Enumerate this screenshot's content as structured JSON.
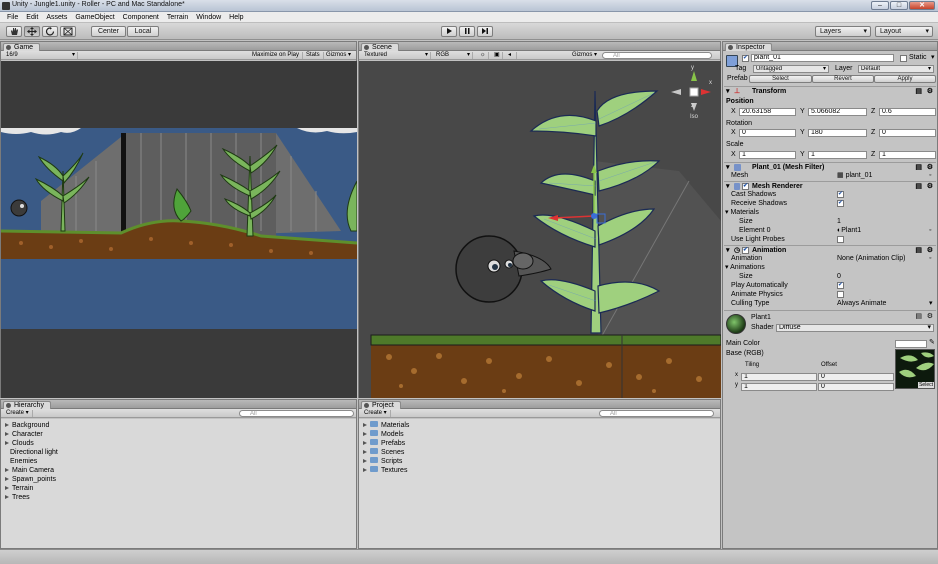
{
  "window": {
    "title": "Unity - Jungle1.unity - Roller - PC and Mac Standalone*",
    "min": "–",
    "max": "□",
    "close": "✕"
  },
  "menu": [
    "File",
    "Edit",
    "Assets",
    "GameObject",
    "Component",
    "Terrain",
    "Window",
    "Help"
  ],
  "toolbar": {
    "pivot": "Center",
    "space": "Local",
    "layers": "Layers",
    "layout": "Layout"
  },
  "game": {
    "tab": "Game",
    "aspect": "16/9",
    "maximize": "Maximize on Play",
    "stats": "Stats",
    "gizmos": "Gizmos"
  },
  "scene": {
    "tab": "Scene",
    "render_mode": "Textured",
    "color_mode": "RGB",
    "gizmos": "Gizmos",
    "search_placeholder": "All",
    "axes": {
      "y": "y",
      "x": "x",
      "z": "z"
    },
    "view_label": "Iso"
  },
  "hierarchy": {
    "tab": "Hierarchy",
    "create": "Create",
    "search_placeholder": "All",
    "items": [
      {
        "label": "Background",
        "expandable": true
      },
      {
        "label": "Character",
        "expandable": true
      },
      {
        "label": "Clouds",
        "expandable": true
      },
      {
        "label": "Directional light",
        "expandable": false
      },
      {
        "label": "Enemies",
        "expandable": false
      },
      {
        "label": "Main Camera",
        "expandable": true
      },
      {
        "label": "Spawn_points",
        "expandable": true
      },
      {
        "label": "Terrain",
        "expandable": true
      },
      {
        "label": "Trees",
        "expandable": true
      }
    ]
  },
  "project": {
    "tab": "Project",
    "create": "Create",
    "search_placeholder": "All",
    "folders": [
      "Materials",
      "Models",
      "Prefabs",
      "Scenes",
      "Scripts",
      "Textures"
    ]
  },
  "inspector": {
    "tab": "Inspector",
    "object_name": "plant_01",
    "static_label": "Static",
    "tag_label": "Tag",
    "tag_value": "Untagged",
    "layer_label": "Layer",
    "layer_value": "Default",
    "prefab_label": "Prefab",
    "prefab_select": "Select",
    "prefab_revert": "Revert",
    "prefab_apply": "Apply",
    "transform": {
      "title": "Transform",
      "position_label": "Position",
      "rotation_label": "Rotation",
      "scale_label": "Scale",
      "x": "X",
      "y": "Y",
      "z": "Z",
      "position": {
        "x": "20.63158",
        "y": "5.066082",
        "z": "0.6"
      },
      "rotation": {
        "x": "0",
        "y": "180",
        "z": "0"
      },
      "scale": {
        "x": "1",
        "y": "1",
        "z": "1"
      }
    },
    "mesh_filter": {
      "title": "Plant_01 (Mesh Filter)",
      "mesh_label": "Mesh",
      "mesh_value": "plant_01"
    },
    "mesh_renderer": {
      "title": "Mesh Renderer",
      "cast_shadows": "Cast Shadows",
      "receive_shadows": "Receive Shadows",
      "materials": "Materials",
      "size_label": "Size",
      "size_value": "1",
      "element0_label": "Element 0",
      "element0_value": "Plant1",
      "light_probes": "Use Light Probes"
    },
    "animation": {
      "title": "Animation",
      "animation_label": "Animation",
      "animation_value": "None (Animation Clip)",
      "animations_label": "Animations",
      "size_label": "Size",
      "size_value": "0",
      "play_auto": "Play Automatically",
      "animate_physics": "Animate Physics",
      "culling_label": "Culling Type",
      "culling_value": "Always Animate"
    },
    "material": {
      "name": "Plant1",
      "shader_label": "Shader",
      "shader_value": "Diffuse",
      "main_color": "Main Color",
      "base_label": "Base (RGB)",
      "tiling": "Tiling",
      "offset": "Offset",
      "x": "x",
      "y": "y",
      "tiling_x": "1",
      "tiling_y": "1",
      "offset_x": "0",
      "offset_y": "0",
      "select": "Select"
    }
  },
  "colors": {
    "sky": "#3a5a86",
    "scene_bg": "#484848",
    "leaf": "#9fd07e",
    "dirt": "#6b3d14"
  }
}
